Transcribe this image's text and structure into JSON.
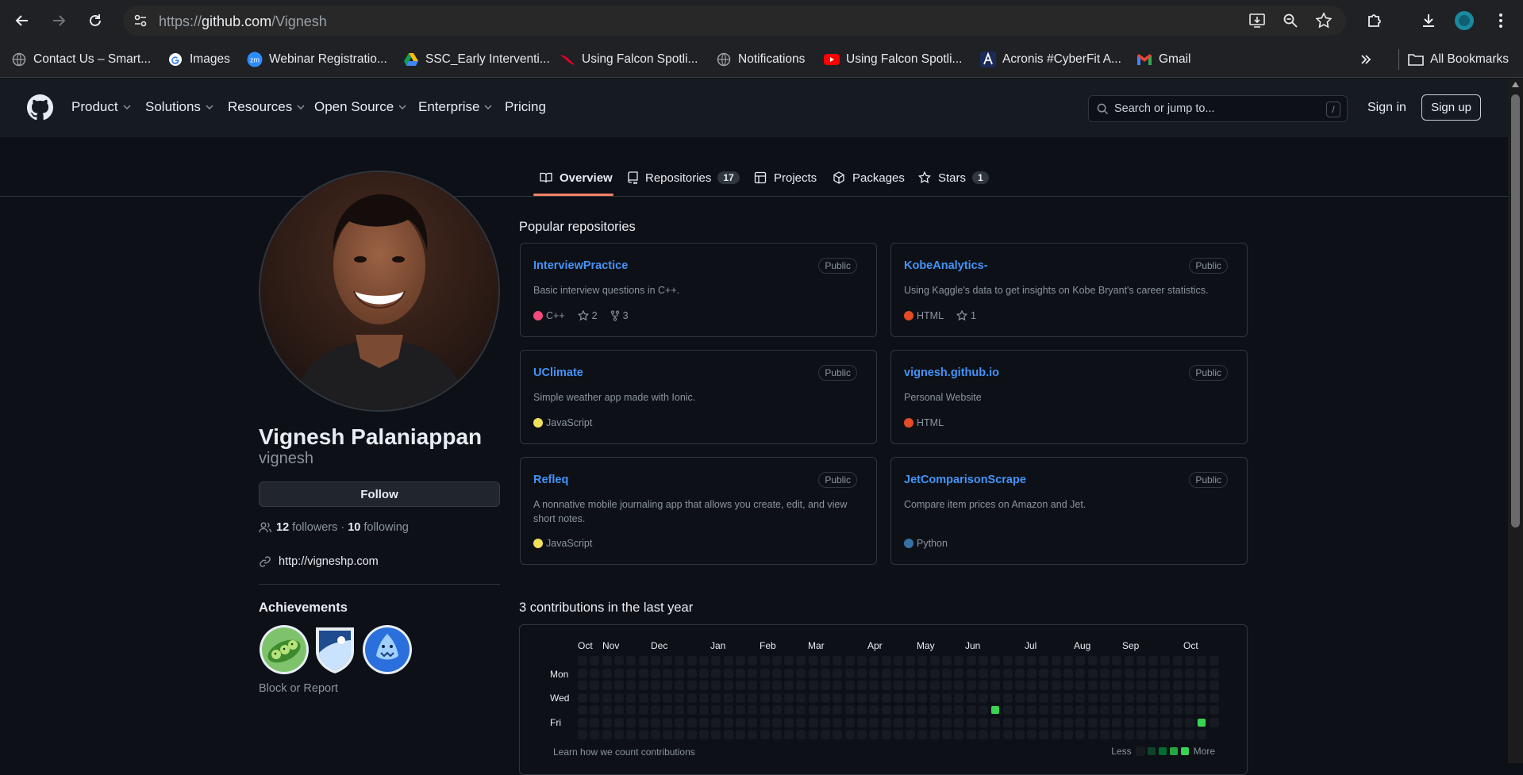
{
  "browser": {
    "url_prefix": "https://",
    "url_host": "github.com",
    "url_path": "/Vignesh",
    "all_bookmarks": "All Bookmarks",
    "bookmarks": [
      {
        "label": "Contact Us – Smart...",
        "icon": "globe-icon"
      },
      {
        "label": "Images",
        "icon": "google-icon"
      },
      {
        "label": "Webinar Registratio...",
        "icon": "zoom-icon"
      },
      {
        "label": "SSC_Early Interventi...",
        "icon": "google-drive-icon"
      },
      {
        "label": "Using Falcon Spotli...",
        "icon": "falcon-icon"
      },
      {
        "label": "Notifications",
        "icon": "globe-icon"
      },
      {
        "label": "Using Falcon Spotli...",
        "icon": "youtube-icon"
      },
      {
        "label": "Acronis #CyberFit A...",
        "icon": "acronis-icon"
      },
      {
        "label": "Gmail",
        "icon": "gmail-icon"
      }
    ]
  },
  "header": {
    "nav": [
      "Product",
      "Solutions",
      "Resources",
      "Open Source",
      "Enterprise",
      "Pricing"
    ],
    "search_placeholder": "Search or jump to...",
    "search_key": "/",
    "signin": "Sign in",
    "signup": "Sign up"
  },
  "tabs": [
    {
      "label": "Overview",
      "count": ""
    },
    {
      "label": "Repositories",
      "count": "17"
    },
    {
      "label": "Projects",
      "count": ""
    },
    {
      "label": "Packages",
      "count": ""
    },
    {
      "label": "Stars",
      "count": "1"
    }
  ],
  "profile": {
    "name": "Vignesh Palaniappan",
    "login": "vignesh",
    "follow": "Follow",
    "followers_count": "12",
    "followers_label": "followers",
    "sep": "·",
    "following_count": "10",
    "following_label": "following",
    "website": "http://vigneshp.com",
    "achievements_title": "Achievements",
    "block_report": "Block or Report"
  },
  "popular": {
    "title": "Popular repositories",
    "repos": [
      {
        "name": "InterviewPractice",
        "visibility": "Public",
        "desc": "Basic interview questions in C++.",
        "lang": "C++",
        "lang_color": "#f34b7d",
        "stars": "2",
        "forks": "3"
      },
      {
        "name": "KobeAnalytics-",
        "visibility": "Public",
        "desc": "Using Kaggle's data to get insights on Kobe Bryant's career statistics.",
        "lang": "HTML",
        "lang_color": "#e34c26",
        "stars": "1",
        "forks": ""
      },
      {
        "name": "UClimate",
        "visibility": "Public",
        "desc": "Simple weather app made with Ionic.",
        "lang": "JavaScript",
        "lang_color": "#f1e05a",
        "stars": "",
        "forks": ""
      },
      {
        "name": "vignesh.github.io",
        "visibility": "Public",
        "desc": "Personal Website",
        "lang": "HTML",
        "lang_color": "#e34c26",
        "stars": "",
        "forks": ""
      },
      {
        "name": "Refleq",
        "visibility": "Public",
        "desc": "A nonnative mobile journaling app that allows you create, edit, and view short notes.",
        "lang": "JavaScript",
        "lang_color": "#f1e05a",
        "stars": "",
        "forks": ""
      },
      {
        "name": "JetComparisonScrape",
        "visibility": "Public",
        "desc": "Compare item prices on Amazon and Jet.",
        "lang": "Python",
        "lang_color": "#3572A5",
        "stars": "",
        "forks": ""
      }
    ]
  },
  "contributions": {
    "title": "3 contributions in the last year",
    "months": [
      "Oct",
      "Nov",
      "Dec",
      "Jan",
      "Feb",
      "Mar",
      "Apr",
      "May",
      "Jun",
      "Jul",
      "Aug",
      "Sep",
      "Oct"
    ],
    "days": [
      "Mon",
      "Wed",
      "Fri"
    ],
    "learn": "Learn how we count contributions",
    "less": "Less",
    "more": "More",
    "active_cells": [
      {
        "week": 34,
        "day": 4,
        "level": 3
      },
      {
        "week": 51,
        "day": 5,
        "level": 3
      }
    ],
    "legend_colors": [
      "#161b22",
      "#0e4429",
      "#006d32",
      "#26a641",
      "#39d353"
    ]
  }
}
